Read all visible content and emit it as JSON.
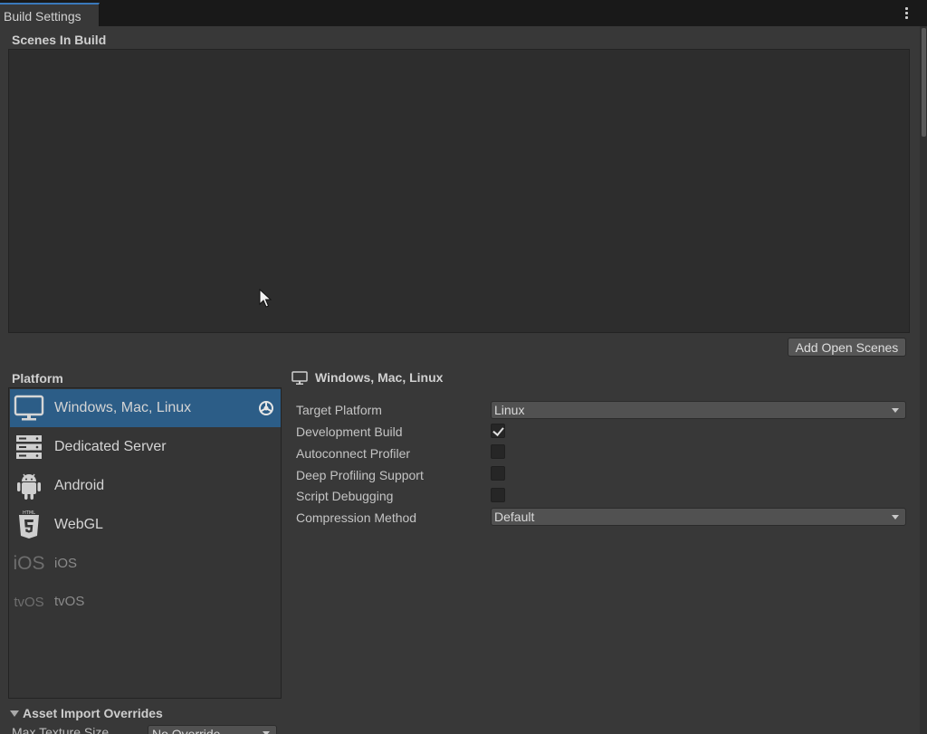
{
  "window": {
    "tab_title": "Build Settings",
    "menu_icon": "kebab-menu-icon"
  },
  "scenes": {
    "header": "Scenes In Build",
    "add_open_scenes_label": "Add Open Scenes"
  },
  "platform": {
    "header": "Platform",
    "items": [
      {
        "label": "Windows, Mac, Linux",
        "icon": "monitor-icon",
        "selected": true,
        "available": true
      },
      {
        "label": "Dedicated Server",
        "icon": "server-icon",
        "selected": false,
        "available": true
      },
      {
        "label": "Android",
        "icon": "android-icon",
        "selected": false,
        "available": true
      },
      {
        "label": "WebGL",
        "icon": "html5-icon",
        "selected": false,
        "available": true
      },
      {
        "label": "iOS",
        "icon_text": "iOS",
        "icon": "ios-icon",
        "selected": false,
        "available": false
      },
      {
        "label": "tvOS",
        "icon_text": "tvOS",
        "icon": "tvos-icon",
        "selected": false,
        "available": false
      }
    ],
    "active_badge_icon": "unity-logo-icon"
  },
  "settings": {
    "title": "Windows, Mac, Linux",
    "target_platform_label": "Target Platform",
    "target_platform_value": "Linux",
    "development_build_label": "Development Build",
    "development_build_checked": true,
    "autoconnect_profiler_label": "Autoconnect Profiler",
    "autoconnect_profiler_checked": false,
    "deep_profiling_label": "Deep Profiling Support",
    "deep_profiling_checked": false,
    "script_debugging_label": "Script Debugging",
    "script_debugging_checked": false,
    "compression_method_label": "Compression Method",
    "compression_method_value": "Default"
  },
  "asset_import": {
    "foldout_label": "Asset Import Overrides",
    "max_texture_size_label": "Max Texture Size",
    "max_texture_size_value": "No Override"
  },
  "colors": {
    "selection": "#2c5d87",
    "tab_accent": "#3a79bb",
    "panel_bg": "#383838"
  }
}
